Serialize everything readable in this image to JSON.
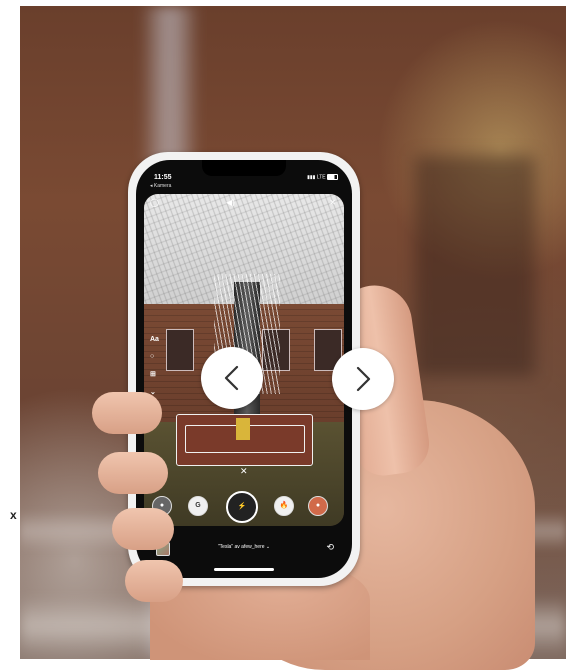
{
  "edge_text": "x",
  "phone": {
    "status": {
      "time": "11:55",
      "back_label": "◂ Kamera",
      "network": "LTE"
    },
    "ar_caption": "",
    "side_tools": [
      "Aa",
      "○",
      "⊞",
      "⌄"
    ],
    "effect_name": "\"Tesla\" av afew_here ⌄"
  },
  "carousel": {
    "prev_icon": "chevron-left-icon",
    "next_icon": "chevron-right-icon"
  },
  "colors": {
    "nav_button_bg": "#ffffff",
    "chevron": "#333333",
    "phone_body": "#f2f2f2"
  }
}
